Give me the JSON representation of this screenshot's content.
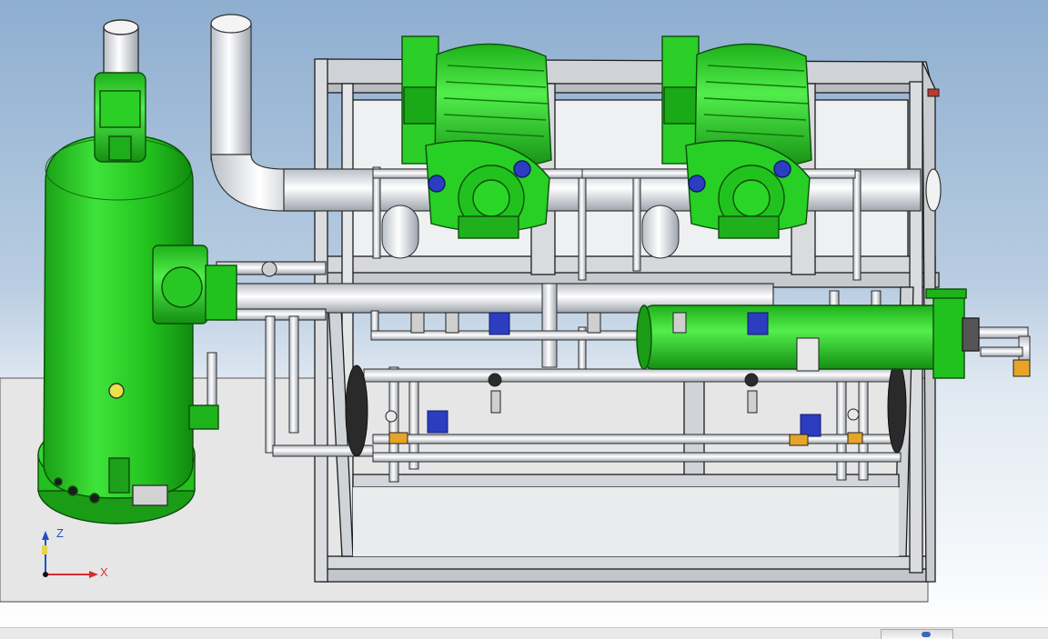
{
  "viewport": {
    "colors": {
      "sky_top": "#8eaed0",
      "floor": "#e6e6e6",
      "frame": "#d6d8dc",
      "edge": "#222222",
      "pipe": "#dfe3e8",
      "component_green": "#22c21e",
      "valve_blue": "#2c3dc0",
      "fitting_orange": "#e6a528",
      "indicator_yellow": "#e9e24a"
    }
  },
  "triad": {
    "z_label": "Z",
    "x_label": "X",
    "z_color": "#2050c8",
    "x_color": "#d82b2b"
  },
  "statusbar": {
    "accent": "#3e68b8"
  }
}
